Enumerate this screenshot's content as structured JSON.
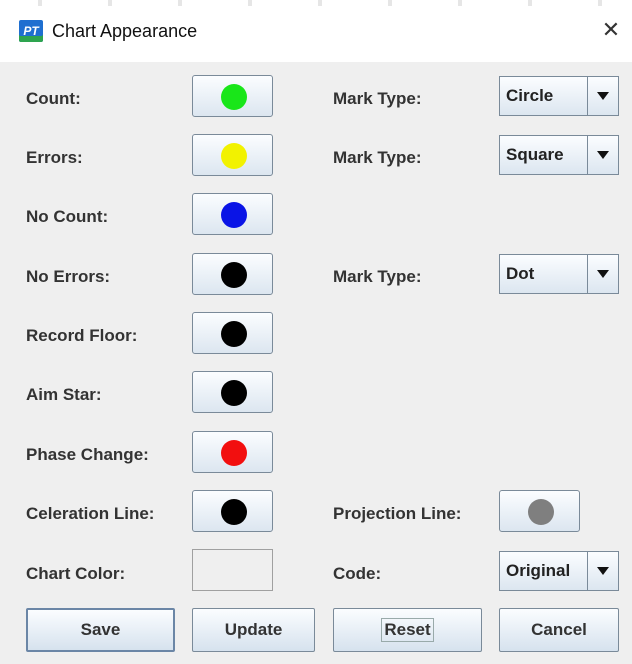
{
  "window": {
    "title": "Chart Appearance",
    "app_icon_text": "PT",
    "close_glyph": "✕"
  },
  "rows": [
    {
      "label": "Count:",
      "color": "#19e619"
    },
    {
      "label": "Errors:",
      "color": "#f2f200"
    },
    {
      "label": "No Count:",
      "color": "#0a14e6"
    },
    {
      "label": "No Errors:",
      "color": "#000000"
    },
    {
      "label": "Record Floor:",
      "color": "#000000"
    },
    {
      "label": "Aim Star:",
      "color": "#000000"
    },
    {
      "label": "Phase Change:",
      "color": "#f20f0f"
    },
    {
      "label": "Celeration Line:",
      "color": "#000000"
    },
    {
      "label": "Chart Color:",
      "color": ""
    }
  ],
  "right": {
    "mark_type_label": "Mark Type:",
    "count_mark": "Circle",
    "errors_mark": "Square",
    "no_errors_mark": "Dot",
    "projection_label": "Projection Line:",
    "projection_color": "#7f7f7f",
    "code_label": "Code:",
    "code_value": "Original"
  },
  "buttons": {
    "save": "Save",
    "update": "Update",
    "reset": "Reset",
    "cancel": "Cancel"
  }
}
